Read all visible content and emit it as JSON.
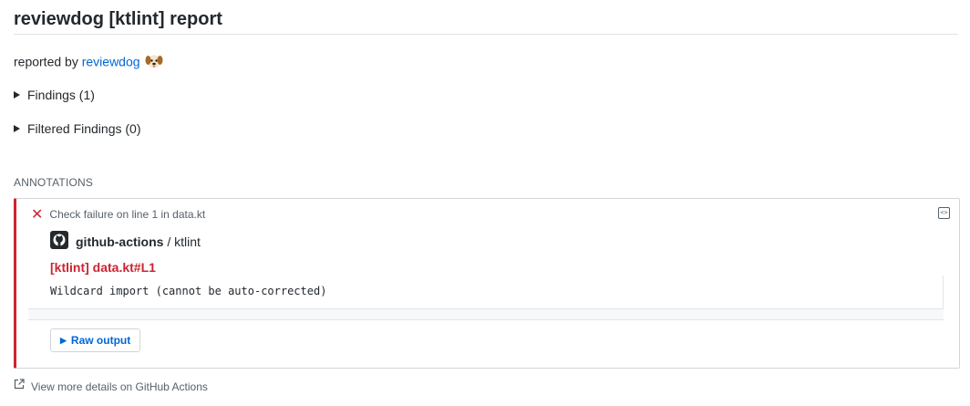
{
  "header": {
    "title": "reviewdog [ktlint] report"
  },
  "report": {
    "prefix": "reported by ",
    "author_link": "reviewdog",
    "author_icon": "dog-emoji-icon"
  },
  "sections": [
    {
      "label": "Findings (1)"
    },
    {
      "label": "Filtered Findings (0)"
    }
  ],
  "annotations": {
    "heading": "ANNOTATIONS",
    "item": {
      "status_icon": "x-icon",
      "summary": "Check failure on line 1 in data.kt",
      "actor_org": "github-actions",
      "actor_sep": " / ",
      "actor_repo": "ktlint",
      "title": "[ktlint] data.kt#L1",
      "message": "Wildcard import (cannot be auto-corrected)",
      "raw_output_label": "Raw output"
    }
  },
  "footer": {
    "link_text": "View more details on GitHub Actions"
  },
  "colors": {
    "error": "#cb2431",
    "link": "#0366d6",
    "text": "#24292e",
    "muted": "#586069"
  }
}
